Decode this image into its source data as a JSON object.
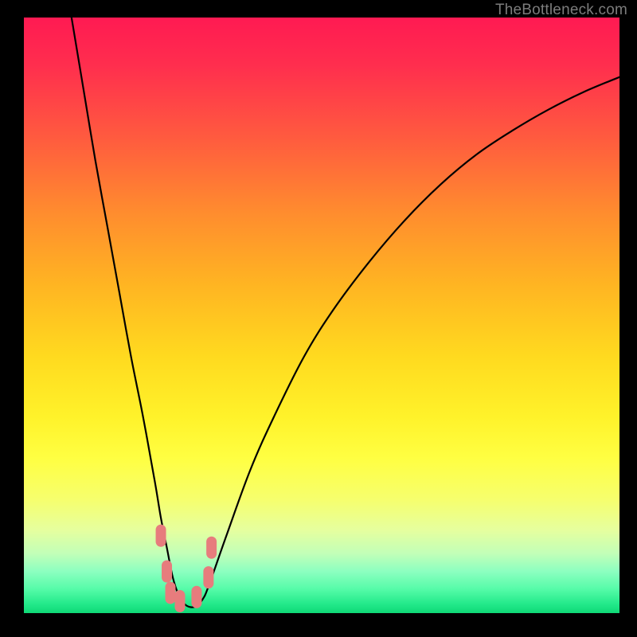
{
  "watermark": "TheBottleneck.com",
  "chart_data": {
    "type": "line",
    "title": "",
    "xlabel": "",
    "ylabel": "",
    "xlim": [
      0,
      100
    ],
    "ylim": [
      0,
      100
    ],
    "grid": false,
    "legend": false,
    "series": [
      {
        "name": "bottleneck-curve",
        "color": "#000000",
        "x": [
          8,
          10,
          12,
          14,
          16,
          18,
          20,
          22,
          23,
          24,
          25,
          26,
          27,
          28,
          29,
          30,
          31,
          34,
          38,
          42,
          47,
          52,
          58,
          64,
          70,
          76,
          82,
          88,
          94,
          100
        ],
        "y": [
          100,
          88,
          76,
          65,
          54,
          43,
          33,
          22,
          16,
          11,
          6,
          3,
          1.5,
          1,
          1.2,
          2.3,
          4.5,
          13,
          24,
          33,
          43,
          51,
          59,
          66,
          72,
          77,
          81,
          84.5,
          87.5,
          90
        ]
      }
    ],
    "annotations": [
      {
        "name": "marker-cluster",
        "color": "#e77c7d",
        "points": [
          {
            "x": 23.0,
            "y": 13.0
          },
          {
            "x": 24.0,
            "y": 7.0
          },
          {
            "x": 24.6,
            "y": 3.4
          },
          {
            "x": 26.2,
            "y": 2.0
          },
          {
            "x": 29.0,
            "y": 2.7
          },
          {
            "x": 31.0,
            "y": 6.0
          },
          {
            "x": 31.5,
            "y": 11.0
          }
        ]
      }
    ]
  }
}
